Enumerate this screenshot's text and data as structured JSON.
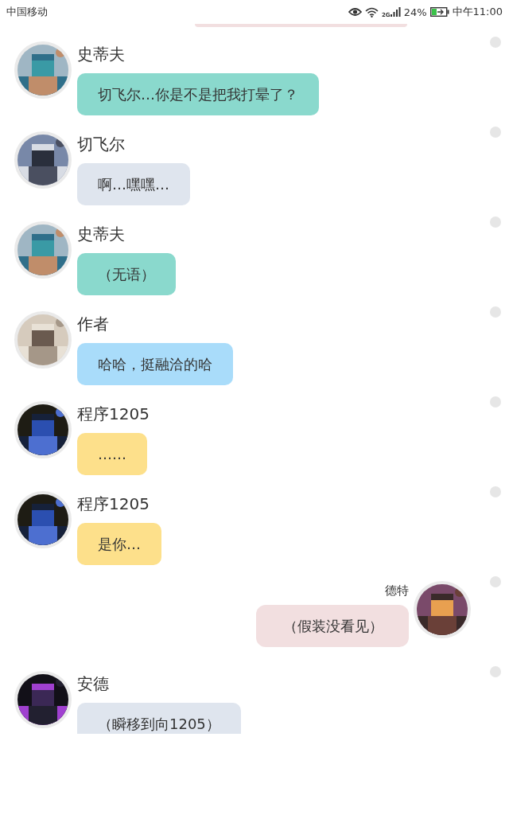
{
  "status_bar": {
    "carrier": "中国移动",
    "network": "2G",
    "battery": "24%",
    "time": "中午11:00"
  },
  "messages": [
    {
      "outgoing": false,
      "sender": "史蒂夫",
      "text": "切飞尔…你是不是把我打晕了？",
      "color": "#8ad9cd"
    },
    {
      "outgoing": false,
      "sender": "切飞尔",
      "text": "啊…嘿嘿…",
      "color": "#dfe5ee"
    },
    {
      "outgoing": false,
      "sender": "史蒂夫",
      "text": "（无语）",
      "color": "#8ad9cd"
    },
    {
      "outgoing": false,
      "sender": "作者",
      "text": "哈哈，挺融洽的哈",
      "color": "#a9dcfa"
    },
    {
      "outgoing": false,
      "sender": "程序1205",
      "text": "……",
      "color": "#fde08b"
    },
    {
      "outgoing": false,
      "sender": "程序1205",
      "text": "是你…",
      "color": "#fde08b"
    },
    {
      "outgoing": true,
      "sender": "德特",
      "text": "（假装没看见）",
      "color": "#f2dfe0"
    },
    {
      "outgoing": false,
      "sender": "安德",
      "text": "（瞬移到向1205）",
      "color": "#dfe5ee"
    }
  ]
}
